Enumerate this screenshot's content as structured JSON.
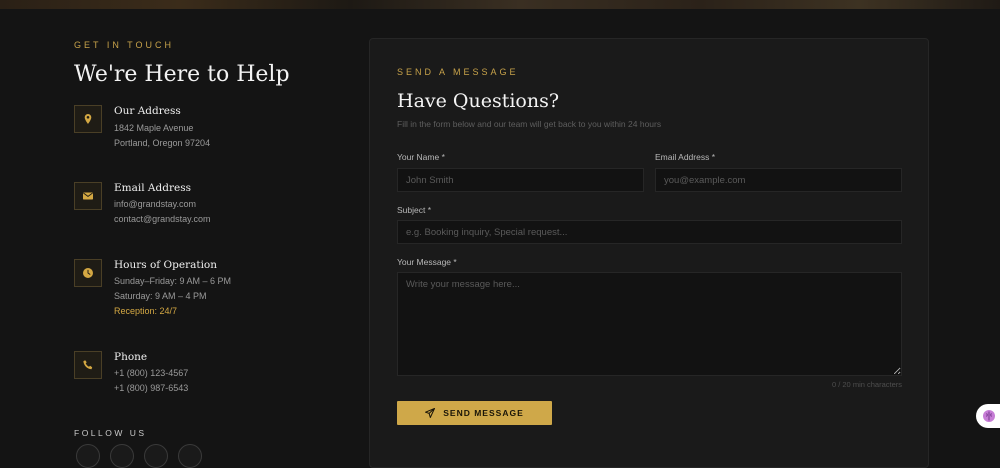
{
  "contact": {
    "eyebrow": "GET IN TOUCH",
    "title": "We're Here to Help",
    "address": {
      "title": "Our Address",
      "line1": "1842 Maple Avenue",
      "line2": "Portland, Oregon 97204",
      "icon": "location-pin-icon"
    },
    "email": {
      "title": "Email Address",
      "line1": "info@grandstay.com",
      "line2": "contact@grandstay.com",
      "icon": "envelope-icon"
    },
    "hours": {
      "title": "Hours of Operation",
      "line1": "Sunday–Friday: 9 AM – 6 PM",
      "line2": "Saturday: 9 AM – 4 PM",
      "line3": "Reception: 24/7",
      "icon": "clock-icon"
    },
    "phone": {
      "title": "Phone",
      "line1": "+1 (800) 123-4567",
      "line2": "+1 (800) 987-6543",
      "icon": "phone-icon"
    },
    "follow_label": "FOLLOW US"
  },
  "form": {
    "eyebrow": "SEND A MESSAGE",
    "title": "Have Questions?",
    "subtitle": "Fill in the form below and our team will get back to you within 24 hours",
    "name_label": "Your Name *",
    "name_placeholder": "John Smith",
    "email_label": "Email Address *",
    "email_placeholder": "you@example.com",
    "subject_label": "Subject *",
    "subject_placeholder": "e.g. Booking inquiry, Special request...",
    "message_label": "Your Message *",
    "message_placeholder": "Write your message here...",
    "counter": "0 / 20 min characters",
    "send_label": "SEND MESSAGE"
  },
  "colors": {
    "accent": "#cfa849",
    "background": "#141414",
    "card": "#1a1a1a"
  }
}
